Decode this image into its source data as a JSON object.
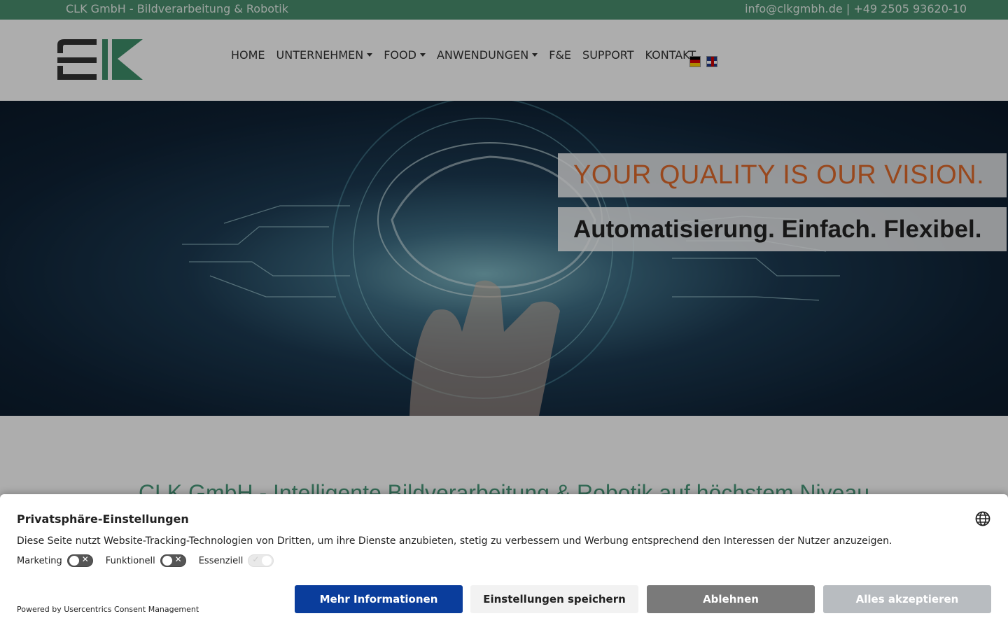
{
  "topbar": {
    "company": "CLK GmbH - Bildverarbeitung & Robotik",
    "contact": "info@clkgmbh.de | +49 2505 93620-10"
  },
  "nav": {
    "items": [
      {
        "label": "HOME",
        "dropdown": false
      },
      {
        "label": "UNTERNEHMEN",
        "dropdown": true
      },
      {
        "label": "FOOD",
        "dropdown": true
      },
      {
        "label": "ANWENDUNGEN",
        "dropdown": true
      },
      {
        "label": "F&E",
        "dropdown": false
      },
      {
        "label": "SUPPORT",
        "dropdown": false
      },
      {
        "label": "KONTAKT",
        "dropdown": false
      }
    ],
    "flags": [
      "flag-de-icon",
      "flag-en-icon"
    ]
  },
  "hero": {
    "claim1": "YOUR QUALITY IS OUR VISION.",
    "claim2": "Automatisierung. Einfach. Flexibel."
  },
  "intro": {
    "title": "CLK GmbH - Intelligente Bildverarbeitung & Robotik auf höchstem Niveau"
  },
  "consent": {
    "title": "Privatsphäre-Einstellungen",
    "text": "Diese Seite nutzt Website-Tracking-Technologien von Dritten, um ihre Dienste anzubieten, stetig zu verbessern und Werbung entsprechend den Interessen der Nutzer anzuzeigen.",
    "toggles": [
      {
        "label": "Marketing",
        "state": "off"
      },
      {
        "label": "Funktionell",
        "state": "off"
      },
      {
        "label": "Essenziell",
        "state": "on-locked"
      }
    ],
    "powered": "Powered by Usercentrics Consent Management",
    "buttons": {
      "more": "Mehr Informationen",
      "save": "Einstellungen speichern",
      "deny": "Ablehnen",
      "accept": "Alles akzeptieren"
    }
  },
  "colors": {
    "brand_green": "#4a8f6f",
    "claim_orange": "#e06a2c",
    "primary_button": "#0a3d9c"
  }
}
